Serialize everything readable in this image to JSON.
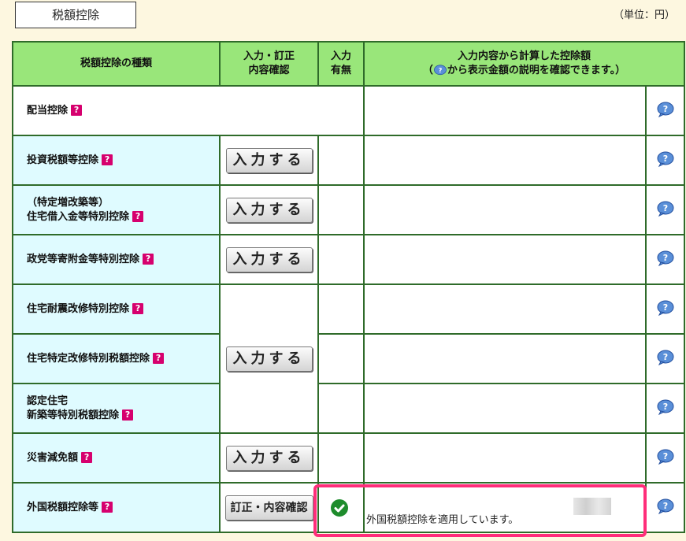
{
  "header": {
    "title": "税額控除",
    "unit": "（単位：円）"
  },
  "table": {
    "col_type": "税額控除の種類",
    "col_input_line1": "入力・訂正",
    "col_input_line2": "内容確認",
    "col_has_line1": "入力",
    "col_has_line2": "有無",
    "col_amount_line1": "入力内容から計算した控除額",
    "col_amount_line2_pre": "（",
    "col_amount_line2_post": "から表示金額の説明を確認できます。）"
  },
  "rows": [
    {
      "label": "配当控除"
    },
    {
      "label": "投資税額等控除",
      "button": "入力する"
    },
    {
      "label_line1": "（特定増改築等）",
      "label_line2": "住宅借入金等特別控除",
      "button": "入力する"
    },
    {
      "label": "政党等寄附金等特別控除",
      "button": "入力する"
    },
    {
      "label": "住宅耐震改修特別控除"
    },
    {
      "label": "住宅特定改修特別税額控除",
      "button": "入力する"
    },
    {
      "label_line1": "認定住宅",
      "label_line2": "新築等特別税額控除"
    },
    {
      "label": "災害減免額",
      "button": "入力する"
    },
    {
      "label": "外国税額控除等",
      "button": "訂正・内容確認",
      "message": "外国税額控除を適用しています。"
    }
  ],
  "icons": {
    "help": "question-badge-icon",
    "bubble": "help-bubble-icon",
    "check": "check-circle-icon"
  },
  "colors": {
    "header_bg": "#99e67a",
    "row_bg": "#dffbff",
    "highlight": "#ff2d7a",
    "check": "#1e8c2c"
  }
}
